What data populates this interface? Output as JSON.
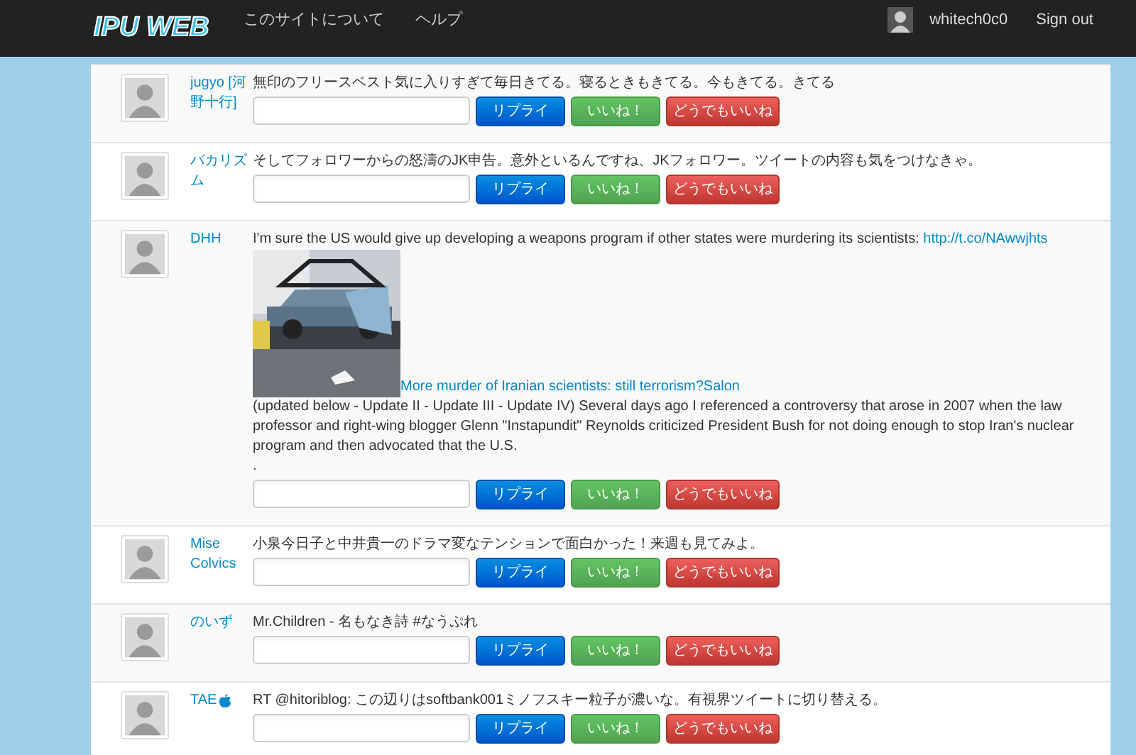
{
  "navbar": {
    "logo": "IPU WEB",
    "links": [
      "このサイトについて",
      "ヘルプ"
    ],
    "user": "whitech0c0",
    "signout": "Sign out"
  },
  "tweets": [
    {
      "user": "jugyo [河野十行]",
      "has_icon": false,
      "kind": "plain",
      "text": "無印のフリースベスト気に入りすぎて毎日きてる。寝るときもきてる。今もきてる。きてる",
      "buttons": [
        {
          "label": "リプライ",
          "kind": "reply"
        },
        {
          "label": "いいね！",
          "kind": "like"
        },
        {
          "label": "どうでもいいね",
          "kind": "meh"
        }
      ]
    },
    {
      "user": "バカリズム",
      "has_icon": false,
      "kind": "plain",
      "text": "そしてフォロワーからの怒濤のJK申告。意外といるんですね、JKフォロワー。ツイートの内容も気をつけなきゃ。",
      "buttons": [
        {
          "label": "リプライ",
          "kind": "reply"
        },
        {
          "label": "いいね！",
          "kind": "like"
        },
        {
          "label": "どうでもいいね",
          "kind": "meh"
        }
      ]
    },
    {
      "user": "DHH",
      "has_icon": false,
      "kind": "link_card",
      "text": "I'm sure the US would give up developing a weapons program if other states were murdering its scientists:",
      "link": "http://t.co/NAwwjhts",
      "card": {
        "kind": "picture",
        "title": "More murder of Iranian scientists: still terrorism?Salon",
        "description": "(updated below - Update II - Update III - Update IV) Several days ago I referenced a controversy that arose in 2007 when the law professor and right-wing blogger Glenn \"Instapundit\" Reynolds criticized President Bush for not doing enough to stop Iran's nuclear program and then advocated that the U.S.",
        "trailer": "."
      },
      "buttons": [
        {
          "label": "リプライ",
          "kind": "reply"
        },
        {
          "label": "いいね！",
          "kind": "like"
        },
        {
          "label": "どうでもいいね",
          "kind": "meh"
        }
      ]
    },
    {
      "user": "Mise Colvics",
      "has_icon": false,
      "kind": "plain",
      "text": "小泉今日子と中井貴一のドラマ変なテンションで面白かった！来週も見てみよ。",
      "buttons": [
        {
          "label": "リプライ",
          "kind": "reply"
        },
        {
          "label": "いいね！",
          "kind": "like"
        },
        {
          "label": "どうでもいいね",
          "kind": "meh"
        }
      ]
    },
    {
      "user": "のいず",
      "has_icon": false,
      "kind": "plain",
      "text": "Mr.Children - 名もなき詩 #なうぷれ",
      "buttons": [
        {
          "label": "リプライ",
          "kind": "reply"
        },
        {
          "label": "いいね！",
          "kind": "like"
        },
        {
          "label": "どうでもいいね",
          "kind": "meh"
        }
      ]
    },
    {
      "user": "TAE",
      "has_icon": true,
      "kind": "plain",
      "text": "RT @hitoriblog: この辺りはsoftbank001ミノフスキー粒子が濃いな。有視界ツイートに切り替える。",
      "buttons": [
        {
          "label": "リプライ",
          "kind": "reply"
        },
        {
          "label": "いいね！",
          "kind": "like"
        },
        {
          "label": "どうでもいいね",
          "kind": "meh"
        }
      ]
    }
  ]
}
